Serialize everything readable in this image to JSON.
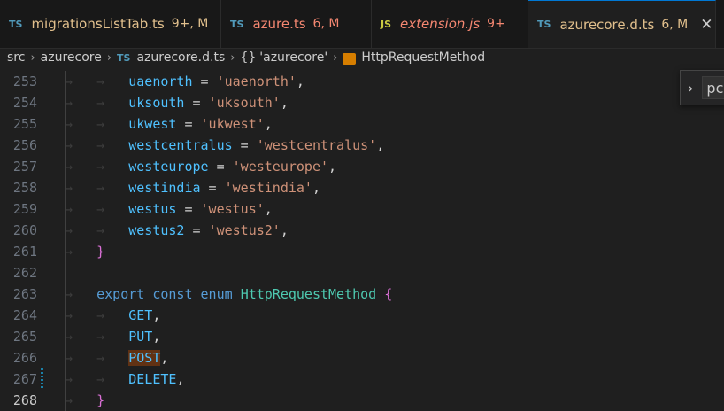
{
  "tabs": [
    {
      "icon": "TS",
      "icon_color": "#519aba",
      "name": "migrationsListTab.ts",
      "status": "9+, M",
      "name_color": "#e2c08d",
      "status_color": "#e2c08d"
    },
    {
      "icon": "TS",
      "icon_color": "#519aba",
      "name": "azure.ts",
      "status": "6, M",
      "name_color": "#f48771",
      "status_color": "#f48771"
    },
    {
      "icon": "JS",
      "icon_color": "#cbcb41",
      "name": "extension.js",
      "status": "9+",
      "name_color": "#f48771",
      "status_color": "#f48771"
    },
    {
      "icon": "TS",
      "icon_color": "#519aba",
      "name": "azurecore.d.ts",
      "status": "6, M",
      "name_color": "#e2c08d",
      "status_color": "#e2c08d",
      "active": true
    }
  ],
  "active_tab_close": "✕",
  "breadcrumb": {
    "items": [
      "src",
      "azurecore",
      "azurecore.d.ts",
      "'azurecore'",
      "HttpRequestMethod"
    ],
    "file_icon": "TS",
    "namespace_icon": "{}",
    "enum_icon": "enum-icon"
  },
  "editor": {
    "lines": [
      {
        "num": "253",
        "indent": 2,
        "tokens": [
          {
            "t": "uaenorth",
            "c": "c-prop"
          },
          {
            "t": " = ",
            "c": "c-op"
          },
          {
            "t": "'uaenorth'",
            "c": "c-str"
          },
          {
            "t": ",",
            "c": "c-op"
          }
        ]
      },
      {
        "num": "254",
        "indent": 2,
        "tokens": [
          {
            "t": "uksouth",
            "c": "c-prop"
          },
          {
            "t": " = ",
            "c": "c-op"
          },
          {
            "t": "'uksouth'",
            "c": "c-str"
          },
          {
            "t": ",",
            "c": "c-op"
          }
        ]
      },
      {
        "num": "255",
        "indent": 2,
        "tokens": [
          {
            "t": "ukwest",
            "c": "c-prop"
          },
          {
            "t": " = ",
            "c": "c-op"
          },
          {
            "t": "'ukwest'",
            "c": "c-str"
          },
          {
            "t": ",",
            "c": "c-op"
          }
        ]
      },
      {
        "num": "256",
        "indent": 2,
        "tokens": [
          {
            "t": "westcentralus",
            "c": "c-prop"
          },
          {
            "t": " = ",
            "c": "c-op"
          },
          {
            "t": "'westcentralus'",
            "c": "c-str"
          },
          {
            "t": ",",
            "c": "c-op"
          }
        ]
      },
      {
        "num": "257",
        "indent": 2,
        "tokens": [
          {
            "t": "westeurope",
            "c": "c-prop"
          },
          {
            "t": " = ",
            "c": "c-op"
          },
          {
            "t": "'westeurope'",
            "c": "c-str"
          },
          {
            "t": ",",
            "c": "c-op"
          }
        ]
      },
      {
        "num": "258",
        "indent": 2,
        "tokens": [
          {
            "t": "westindia",
            "c": "c-prop"
          },
          {
            "t": " = ",
            "c": "c-op"
          },
          {
            "t": "'westindia'",
            "c": "c-str"
          },
          {
            "t": ",",
            "c": "c-op"
          }
        ]
      },
      {
        "num": "259",
        "indent": 2,
        "tokens": [
          {
            "t": "westus",
            "c": "c-prop"
          },
          {
            "t": " = ",
            "c": "c-op"
          },
          {
            "t": "'westus'",
            "c": "c-str"
          },
          {
            "t": ",",
            "c": "c-op"
          }
        ]
      },
      {
        "num": "260",
        "indent": 2,
        "tokens": [
          {
            "t": "westus2",
            "c": "c-prop"
          },
          {
            "t": " = ",
            "c": "c-op"
          },
          {
            "t": "'westus2'",
            "c": "c-str"
          },
          {
            "t": ",",
            "c": "c-op"
          }
        ]
      },
      {
        "num": "261",
        "indent": 1,
        "tokens": [
          {
            "t": "}",
            "c": "c-brace"
          }
        ]
      },
      {
        "num": "262",
        "indent": 0,
        "tokens": []
      },
      {
        "num": "263",
        "indent": 1,
        "tokens": [
          {
            "t": "export",
            "c": "c-kw"
          },
          {
            "t": " ",
            "c": "c-op"
          },
          {
            "t": "const",
            "c": "c-kw"
          },
          {
            "t": " ",
            "c": "c-op"
          },
          {
            "t": "enum",
            "c": "c-kw"
          },
          {
            "t": " ",
            "c": "c-op"
          },
          {
            "t": "HttpRequestMethod",
            "c": "c-type"
          },
          {
            "t": " ",
            "c": "c-op"
          },
          {
            "t": "{",
            "c": "c-brace"
          }
        ]
      },
      {
        "num": "264",
        "indent": 2,
        "tokens": [
          {
            "t": "GET",
            "c": "c-prop"
          },
          {
            "t": ",",
            "c": "c-op"
          }
        ]
      },
      {
        "num": "265",
        "indent": 2,
        "tokens": [
          {
            "t": "PUT",
            "c": "c-prop"
          },
          {
            "t": ",",
            "c": "c-op"
          }
        ]
      },
      {
        "num": "266",
        "indent": 2,
        "tokens": [
          {
            "t": "POST",
            "c": "c-prop hl"
          },
          {
            "t": ",",
            "c": "c-op"
          }
        ]
      },
      {
        "num": "267",
        "indent": 2,
        "tokens": [
          {
            "t": "DELETE",
            "c": "c-prop"
          },
          {
            "t": ",",
            "c": "c-op"
          }
        ],
        "modified": true
      },
      {
        "num": "268",
        "indent": 1,
        "tokens": [
          {
            "t": "}",
            "c": "c-brace"
          }
        ],
        "current": true
      }
    ]
  },
  "find_widget": {
    "chevron": "›",
    "value": "pc"
  },
  "colors": {
    "accent": "#0078d4",
    "editor_bg": "#1f1f1f",
    "tabbar_bg": "#181818"
  }
}
